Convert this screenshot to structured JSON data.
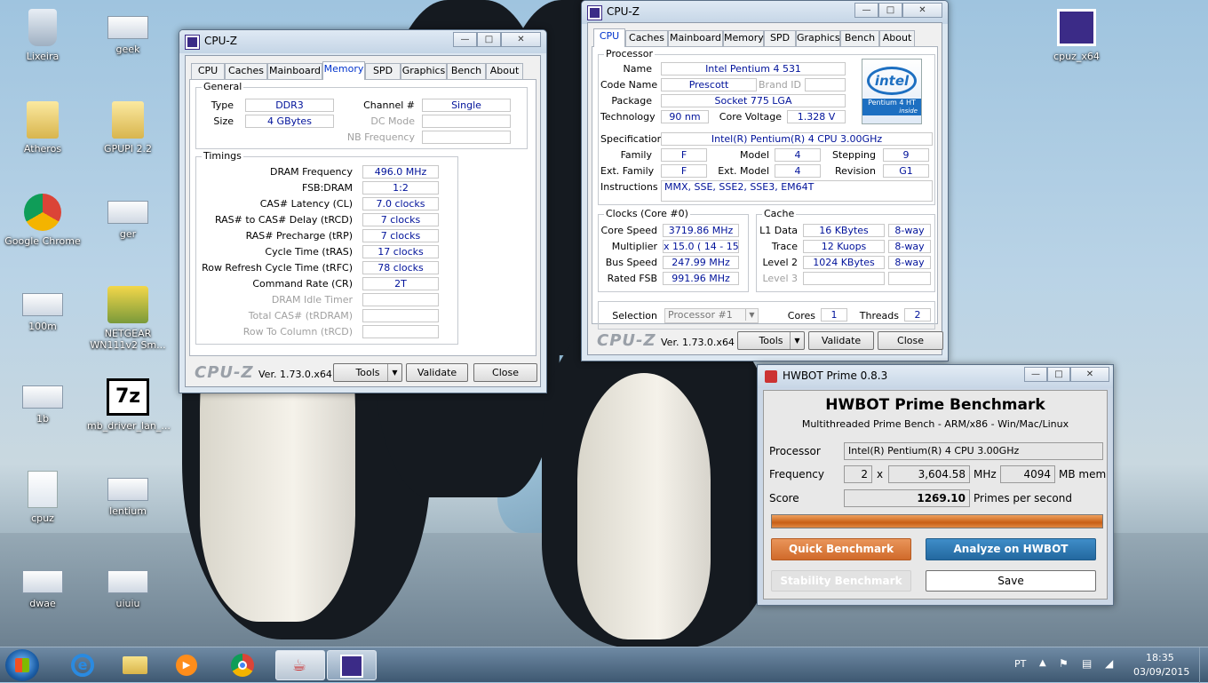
{
  "desktop": {
    "icons": [
      {
        "label": "Lixeira",
        "icon": "recycle-bin-icon"
      },
      {
        "label": "geek",
        "icon": "screenshot-thumbnail-icon"
      },
      {
        "label": "Atheros",
        "icon": "folder-icon"
      },
      {
        "label": "GPUPI 2.2",
        "icon": "folder-icon"
      },
      {
        "label": "Google Chrome",
        "icon": "chrome-icon"
      },
      {
        "label": "ger",
        "icon": "screenshot-thumbnail-icon"
      },
      {
        "label": "100m",
        "icon": "screenshot-thumbnail-icon"
      },
      {
        "label": "NETGEAR WN111v2 Sm...",
        "icon": "netgear-icon"
      },
      {
        "label": "1b",
        "icon": "screenshot-thumbnail-icon"
      },
      {
        "label": "mb_driver_lan_...",
        "icon": "7zip-icon"
      },
      {
        "label": "cpuz",
        "icon": "settings-file-icon"
      },
      {
        "label": "lentium",
        "icon": "screenshot-thumbnail-icon"
      },
      {
        "label": "dwae",
        "icon": "screenshot-thumbnail-icon"
      },
      {
        "label": "uiuiu",
        "icon": "screenshot-thumbnail-icon"
      },
      {
        "label": "cpuz_x64",
        "icon": "cpuz-icon"
      }
    ]
  },
  "cpuz_memory": {
    "title": "CPU-Z",
    "tabs": [
      "CPU",
      "Caches",
      "Mainboard",
      "Memory",
      "SPD",
      "Graphics",
      "Bench",
      "About"
    ],
    "active_tab": "Memory",
    "general": {
      "group": "General",
      "type_label": "Type",
      "type": "DDR3",
      "size_label": "Size",
      "size": "4 GBytes",
      "channel_label": "Channel #",
      "channel": "Single",
      "dc_label": "DC Mode",
      "nb_label": "NB Frequency"
    },
    "timings": {
      "group": "Timings",
      "rows": [
        {
          "label": "DRAM Frequency",
          "value": "496.0 MHz",
          "enabled": true
        },
        {
          "label": "FSB:DRAM",
          "value": "1:2",
          "enabled": true
        },
        {
          "label": "CAS# Latency (CL)",
          "value": "7.0 clocks",
          "enabled": true
        },
        {
          "label": "RAS# to CAS# Delay (tRCD)",
          "value": "7 clocks",
          "enabled": true
        },
        {
          "label": "RAS# Precharge (tRP)",
          "value": "7 clocks",
          "enabled": true
        },
        {
          "label": "Cycle Time (tRAS)",
          "value": "17 clocks",
          "enabled": true
        },
        {
          "label": "Row Refresh Cycle Time (tRFC)",
          "value": "78 clocks",
          "enabled": true
        },
        {
          "label": "Command Rate (CR)",
          "value": "2T",
          "enabled": true
        },
        {
          "label": "DRAM Idle Timer",
          "value": "",
          "enabled": false
        },
        {
          "label": "Total CAS# (tRDRAM)",
          "value": "",
          "enabled": false
        },
        {
          "label": "Row To Column (tRCD)",
          "value": "",
          "enabled": false
        }
      ]
    },
    "footer": {
      "logo": "CPU-Z",
      "version": "Ver. 1.73.0.x64",
      "tools": "Tools",
      "validate": "Validate",
      "close": "Close"
    }
  },
  "cpuz_cpu": {
    "title": "CPU-Z",
    "tabs": [
      "CPU",
      "Caches",
      "Mainboard",
      "Memory",
      "SPD",
      "Graphics",
      "Bench",
      "About"
    ],
    "active_tab": "CPU",
    "processor": {
      "group": "Processor",
      "name_label": "Name",
      "name": "Intel Pentium 4 531",
      "codename_label": "Code Name",
      "codename": "Prescott",
      "brandid_label": "Brand ID",
      "package_label": "Package",
      "package": "Socket 775 LGA",
      "tech_label": "Technology",
      "tech": "90 nm",
      "voltage_label": "Core Voltage",
      "voltage": "1.328 V",
      "spec_label": "Specification",
      "spec": "Intel(R) Pentium(R) 4 CPU 3.00GHz",
      "family_label": "Family",
      "family": "F",
      "model_label": "Model",
      "model": "4",
      "stepping_label": "Stepping",
      "stepping": "9",
      "extfamily_label": "Ext. Family",
      "extfamily": "F",
      "extmodel_label": "Ext. Model",
      "extmodel": "4",
      "revision_label": "Revision",
      "revision": "G1",
      "instr_label": "Instructions",
      "instr": "MMX, SSE, SSE2, SSE3, EM64T",
      "badge": {
        "brand": "intel",
        "line1": "Pentium 4 HT",
        "line2": "inside"
      }
    },
    "clocks": {
      "group": "Clocks (Core #0)",
      "core_label": "Core Speed",
      "core": "3719.86 MHz",
      "mult_label": "Multiplier",
      "mult": "x 15.0 ( 14 - 15 )",
      "bus_label": "Bus Speed",
      "bus": "247.99 MHz",
      "fsb_label": "Rated FSB",
      "fsb": "991.96 MHz"
    },
    "cache": {
      "group": "Cache",
      "l1_label": "L1 Data",
      "l1": "16 KBytes",
      "l1w": "8-way",
      "trace_label": "Trace",
      "trace": "12 Kuops",
      "tracew": "8-way",
      "l2_label": "Level 2",
      "l2": "1024 KBytes",
      "l2w": "8-way",
      "l3_label": "Level 3"
    },
    "selection_label": "Selection",
    "selection": "Processor #1",
    "cores_label": "Cores",
    "cores": "1",
    "threads_label": "Threads",
    "threads": "2",
    "footer": {
      "logo": "CPU-Z",
      "version": "Ver. 1.73.0.x64",
      "tools": "Tools",
      "validate": "Validate",
      "close": "Close"
    }
  },
  "hwbot": {
    "title": "HWBOT Prime 0.8.3",
    "heading": "HWBOT Prime Benchmark",
    "subheading": "Multithreaded Prime Bench - ARM/x86 - Win/Mac/Linux",
    "processor_label": "Processor",
    "processor": "Intel(R) Pentium(R) 4 CPU 3.00GHz",
    "frequency_label": "Frequency",
    "threads": "2",
    "x": "x",
    "freq": "3,604.58",
    "mhz": "MHz",
    "mem": "4094",
    "mem_unit": "MB mem",
    "score_label": "Score",
    "score": "1269.10",
    "score_unit": "Primes per second",
    "progress": 1.0,
    "quick": "Quick Benchmark",
    "analyze": "Analyze on HWBOT",
    "stability": "Stability Benchmark",
    "save": "Save"
  },
  "taskbar": {
    "lang": "PT",
    "time": "18:35",
    "date": "03/09/2015"
  },
  "colors": {
    "accent_orange": "#d9762e",
    "accent_blue": "#2b7bb8",
    "cpuz_blue": "#00129a"
  }
}
